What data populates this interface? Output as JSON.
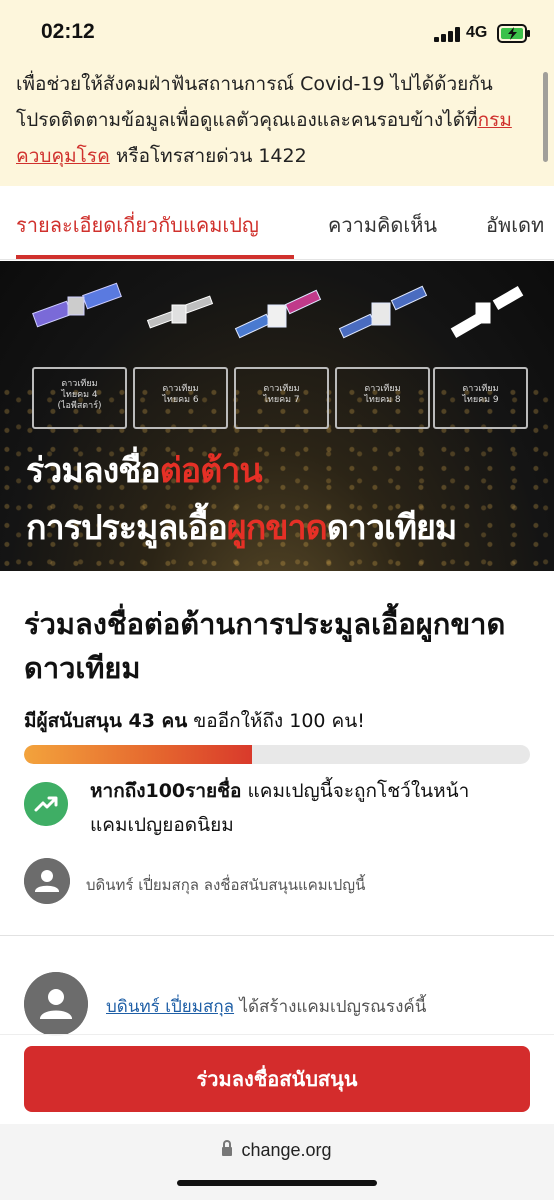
{
  "status_bar": {
    "time": "02:12",
    "network": "4G"
  },
  "notice": {
    "text_before": "เพื่อช่วยให้สังคมฝ่าฟันสถานการณ์ Covid-19 ไปได้ด้วยกัน โปรดติดตามข้อมูลเพื่อดูแลตัวคุณเองและคนรอบข้างได้ที่",
    "link": "กรมควบคุมโรค",
    "text_after": " หรือโทรสายด่วน 1422"
  },
  "tabs": [
    {
      "label": "รายละเอียดเกี่ยวกับแคมเปญ",
      "active": true
    },
    {
      "label": "ความคิดเห็น",
      "active": false
    },
    {
      "label": "อัพเดท",
      "active": false
    }
  ],
  "hero": {
    "satellites": [
      "ดาวเทียม\nไทยคม 4\n(ไอพีสตาร์)",
      "ดาวเทียม\nไทยคม 6",
      "ดาวเทียม\nไทยคม 7",
      "ดาวเทียม\nไทยคม 8",
      "ดาวเทียม\nไทยคม 9"
    ],
    "headline1_a": "ร่วมลงชื่อ",
    "headline1_b": "ต่อต้าน",
    "headline2_a": "การประมูลเอื้อ",
    "headline2_b": "ผูกขาด",
    "headline2_c": "ดาวเทียม"
  },
  "campaign": {
    "title": "ร่วมลงชื่อต่อต้านการประมูลเอื้อผูกขาดดาวเทียม",
    "support_prefix": "มีผู้สนับสนุน ",
    "support_count": "43 คน",
    "support_suffix": " ขออีกให้ถึง 100 คน!",
    "progress": 0.45,
    "trend_bold": "หากถึง100รายชื่อ",
    "trend_rest": " แคมเปญนี้จะถูกโชว์ในหน้าแคมเปญยอดนิยม",
    "recent_signer": "บดินทร์ เปี่ยมสกุล ลงชื่อสนับสนุนแคมเปญนี้",
    "creator_name": "บดินทร์ เปี่ยมสกุล",
    "creator_suffix": " ได้สร้างแคมเปญรณรงค์นี้"
  },
  "cta_label": "ร่วมลงชื่อสนับสนุน",
  "browser": {
    "url": "change.org"
  },
  "colors": {
    "accent": "#d42c2c",
    "link": "#1f5fa6",
    "trend": "#3fae65",
    "banner": "#fdf6dc"
  }
}
